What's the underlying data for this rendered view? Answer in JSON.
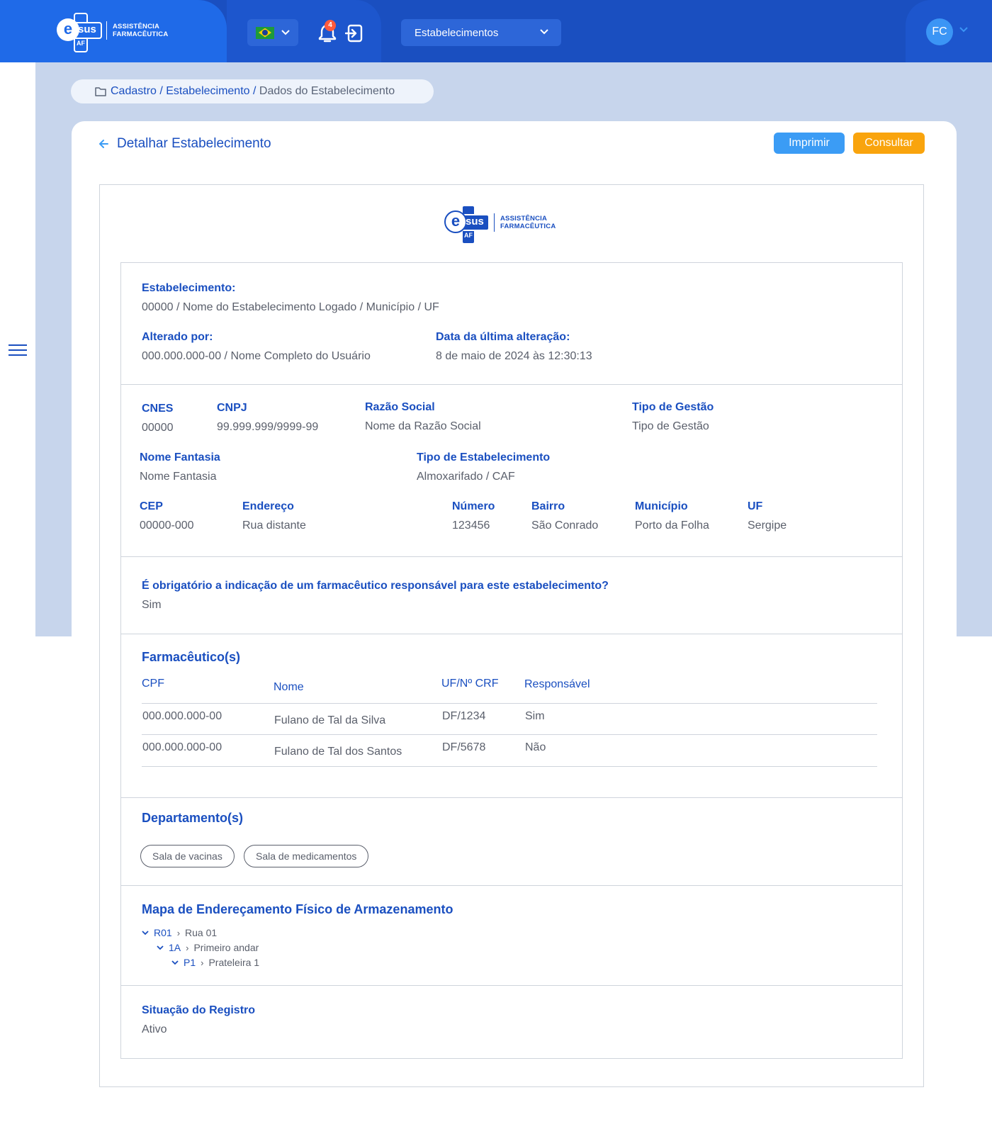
{
  "header": {
    "brand_line1": "ASSISTÊNCIA",
    "brand_line2": "FARMACÊUTICA",
    "brand_e": "e",
    "brand_sus": "sus",
    "brand_af": "AF",
    "notification_count": "4",
    "establishment_select": "Estabelecimentos",
    "user_initials": "FC"
  },
  "breadcrumb": {
    "path": "Cadastro / Estabelecimento / ",
    "current": "Dados do Estabelecimento"
  },
  "page": {
    "title": "Detalhar Estabelecimento",
    "print_label": "Imprimir",
    "consult_label": "Consultar"
  },
  "summary": {
    "estab_label": "Estabelecimento:",
    "estab_value": "00000 / Nome do Estabelecimento Logado / Município / UF",
    "altered_by_label": "Alterado por:",
    "altered_by_value": "000.000.000-00 / Nome Completo do Usuário",
    "last_change_label": "Data da última alteração:",
    "last_change_value": "8 de maio de 2024 às 12:30:13"
  },
  "details": {
    "cnes_label": "CNES",
    "cnes_value": "00000",
    "cnpj_label": "CNPJ",
    "cnpj_value": "99.999.999/9999-99",
    "razao_label": "Razão Social",
    "razao_value": "Nome da Razão Social",
    "gestao_label": "Tipo de Gestão",
    "gestao_value": "Tipo de Gestão",
    "fantasia_label": "Nome Fantasia",
    "fantasia_value": "Nome Fantasia",
    "tipo_label": "Tipo de Estabelecimento",
    "tipo_value": "Almoxarifado / CAF",
    "cep_label": "CEP",
    "cep_value": "00000-000",
    "endereco_label": "Endereço",
    "endereco_value": "Rua distante",
    "numero_label": "Número",
    "numero_value": "123456",
    "bairro_label": "Bairro",
    "bairro_value": "São Conrado",
    "municipio_label": "Município",
    "municipio_value": "Porto da Folha",
    "uf_label": "UF",
    "uf_value": "Sergipe"
  },
  "obligation": {
    "question": "É obrigatório a indicação de um farmacêutico responsável para este estabelecimento?",
    "answer": "Sim"
  },
  "pharmacists": {
    "title": "Farmacêutico(s)",
    "columns": [
      "CPF",
      "Nome",
      "UF/Nº CRF",
      "Responsável"
    ],
    "rows": [
      [
        "000.000.000-00",
        "Fulano de Tal da Silva",
        "DF/1234",
        "Sim"
      ],
      [
        "000.000.000-00",
        "Fulano de Tal dos Santos",
        "DF/5678",
        "Não"
      ]
    ]
  },
  "departments": {
    "title": "Departamento(s)",
    "items": [
      "Sala de vacinas",
      "Sala de medicamentos"
    ]
  },
  "storage_map": {
    "title": "Mapa de Endereçamento Físico de Armazenamento",
    "nodes": [
      {
        "code": "R01",
        "name": "Rua 01"
      },
      {
        "code": "1A",
        "name": "Primeiro andar"
      },
      {
        "code": "P1",
        "name": "Prateleira 1"
      }
    ]
  },
  "status": {
    "label": "Situação do Registro",
    "value": "Ativo"
  },
  "colors": {
    "primary": "#1a4fc0",
    "print_button": "#3b9cf5",
    "consult_button": "#f9a40d"
  }
}
